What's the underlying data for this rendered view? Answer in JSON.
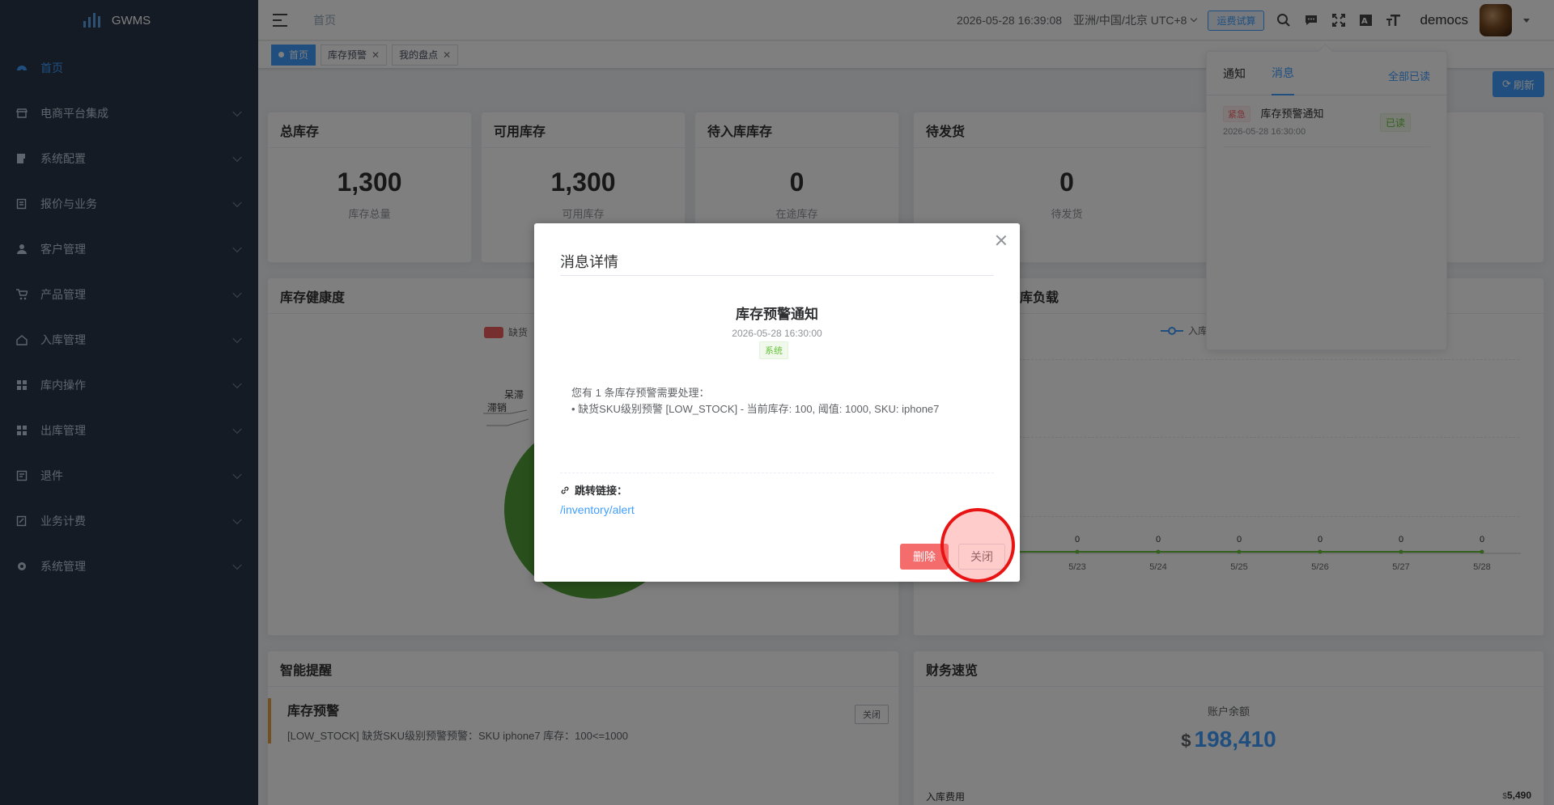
{
  "app": {
    "name": "GWMS"
  },
  "sidebar": {
    "items": [
      {
        "label": "首页",
        "icon": "dashboard-icon",
        "active": true,
        "expandable": false
      },
      {
        "label": "电商平台集成",
        "icon": "store-icon",
        "expandable": true
      },
      {
        "label": "系统配置",
        "icon": "config-icon",
        "expandable": true
      },
      {
        "label": "报价与业务",
        "icon": "quote-icon",
        "expandable": true
      },
      {
        "label": "客户管理",
        "icon": "user-icon",
        "expandable": true
      },
      {
        "label": "产品管理",
        "icon": "cart-icon",
        "expandable": true
      },
      {
        "label": "入库管理",
        "icon": "home-icon",
        "expandable": true
      },
      {
        "label": "库内操作",
        "icon": "grid-icon",
        "expandable": true
      },
      {
        "label": "出库管理",
        "icon": "blocks-icon",
        "expandable": true
      },
      {
        "label": "退件",
        "icon": "return-icon",
        "expandable": true
      },
      {
        "label": "业务计费",
        "icon": "billing-icon",
        "expandable": true
      },
      {
        "label": "系统管理",
        "icon": "gear-icon",
        "expandable": true
      }
    ]
  },
  "header": {
    "breadcrumb": "首页",
    "datetime": "2026-05-28 16:39:08",
    "timezone": "亚洲/中国/北京 UTC+8",
    "trial_button": "运费试算",
    "username": "democs"
  },
  "tags": [
    {
      "label": "首页",
      "active": true
    },
    {
      "label": "库存预警",
      "active": false
    },
    {
      "label": "我的盘点",
      "active": false
    }
  ],
  "refresh_button": "刷新",
  "stats": [
    {
      "title": "总库存",
      "value": "1,300",
      "sub": "库存总量"
    },
    {
      "title": "可用库存",
      "value": "1,300",
      "sub": "可用库存"
    },
    {
      "title": "待入库库存",
      "value": "0",
      "sub": "在途库存"
    },
    {
      "title": "待发货",
      "value": "0",
      "sub": "待发货"
    }
  ],
  "health_panel": {
    "title": "库存健康度",
    "legend": "缺货",
    "labels": [
      "呆滞",
      "滞销"
    ]
  },
  "load_panel": {
    "title": "库负载",
    "legend": "入库"
  },
  "chart_data": {
    "type": "line",
    "x": [
      "5/23",
      "5/24",
      "5/25",
      "5/26",
      "5/27",
      "5/28"
    ],
    "series": [
      {
        "name": "入库",
        "values": [
          0,
          0,
          0,
          0,
          0,
          0
        ]
      }
    ],
    "colors": {
      "line": "#67c23a",
      "legend": "#409eff"
    }
  },
  "reminders": {
    "title": "智能提醒",
    "item_title": "库存预警",
    "item_body": "[LOW_STOCK] 缺货SKU级别预警预警：SKU iphone7 库存：100<=1000",
    "close_label": "关闭"
  },
  "finance": {
    "title": "财务速览",
    "balance_label": "账户余额",
    "currency": "$",
    "balance": "198,410",
    "row_label": "入库费用",
    "row_currency": "$",
    "row_value": "5,490"
  },
  "popover": {
    "tab_notice": "通知",
    "tab_message": "消息",
    "mark_all_read": "全部已读",
    "item": {
      "badge": "紧急",
      "title": "库存预警通知",
      "time": "2026-05-28 16:30:00",
      "status": "已读"
    }
  },
  "dialog": {
    "title": "消息详情",
    "msg_title": "库存预警通知",
    "msg_time": "2026-05-28 16:30:00",
    "msg_tag": "系统",
    "body_line1": "您有 1 条库存预警需要处理：",
    "body_line2": "• 缺货SKU级别预警 [LOW_STOCK] - 当前库存: 100, 阈值: 1000, SKU: iphone7",
    "link_label": "跳转链接：",
    "link_url": "/inventory/alert",
    "delete_button": "删除",
    "close_button": "关闭"
  }
}
